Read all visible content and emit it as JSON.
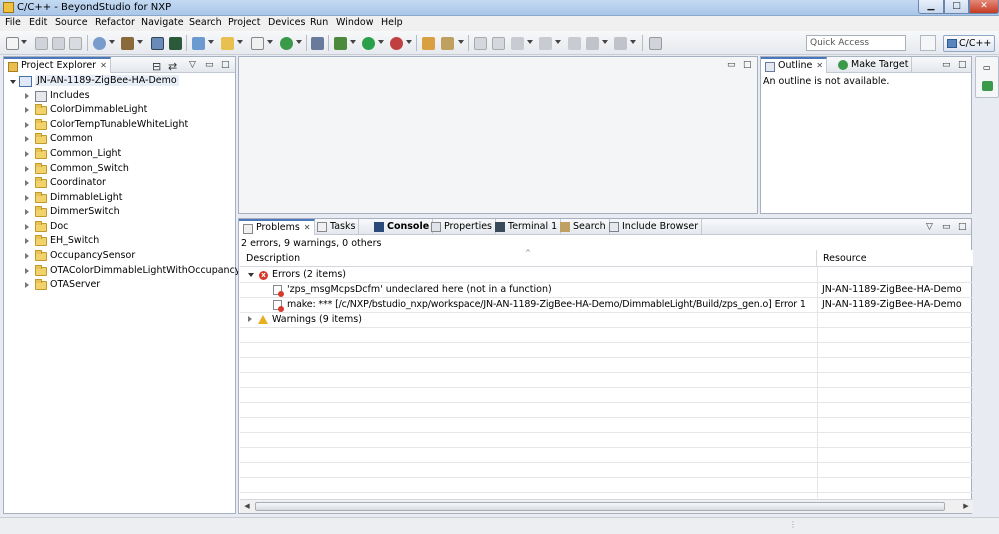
{
  "window": {
    "title": "C/C++ - BeyondStudio for NXP"
  },
  "menu": [
    "File",
    "Edit",
    "Source",
    "Refactor",
    "Navigate",
    "Search",
    "Project",
    "Devices",
    "Run",
    "Window",
    "Help"
  ],
  "toolbar": {
    "quick_access_placeholder": "Quick Access",
    "perspective_label": "C/C++"
  },
  "project_explorer": {
    "tab_label": "Project Explorer",
    "project": "JN-AN-1189-ZigBee-HA-Demo",
    "items": [
      "Includes",
      "ColorDimmableLight",
      "ColorTempTunableWhiteLight",
      "Common",
      "Common_Light",
      "Common_Switch",
      "Coordinator",
      "DimmableLight",
      "DimmerSwitch",
      "Doc",
      "EH_Switch",
      "OccupancySensor",
      "OTAColorDimmableLightWithOccupancy",
      "OTAServer"
    ]
  },
  "outline": {
    "tab_outline": "Outline",
    "tab_make_target": "Make Target",
    "message": "An outline is not available."
  },
  "bottom_panel": {
    "tabs": [
      "Problems",
      "Tasks",
      "Console",
      "Properties",
      "Terminal 1",
      "Search",
      "Include Browser"
    ],
    "summary": "2 errors, 9 warnings, 0 others",
    "columns": {
      "description": "Description",
      "resource": "Resource"
    },
    "errors_group": "Errors (2 items)",
    "errors": [
      {
        "description": "'zps_msgMcpsDcfm' undeclared here (not in a function)",
        "resource": "JN-AN-1189-ZigBee-HA-Demo"
      },
      {
        "description": "make: *** [/c/NXP/bstudio_nxp/workspace/JN-AN-1189-ZigBee-HA-Demo/DimmableLight/Build/zps_gen.o] Error 1",
        "resource": "JN-AN-1189-ZigBee-HA-Demo"
      }
    ],
    "warnings_group": "Warnings (9 items)"
  }
}
